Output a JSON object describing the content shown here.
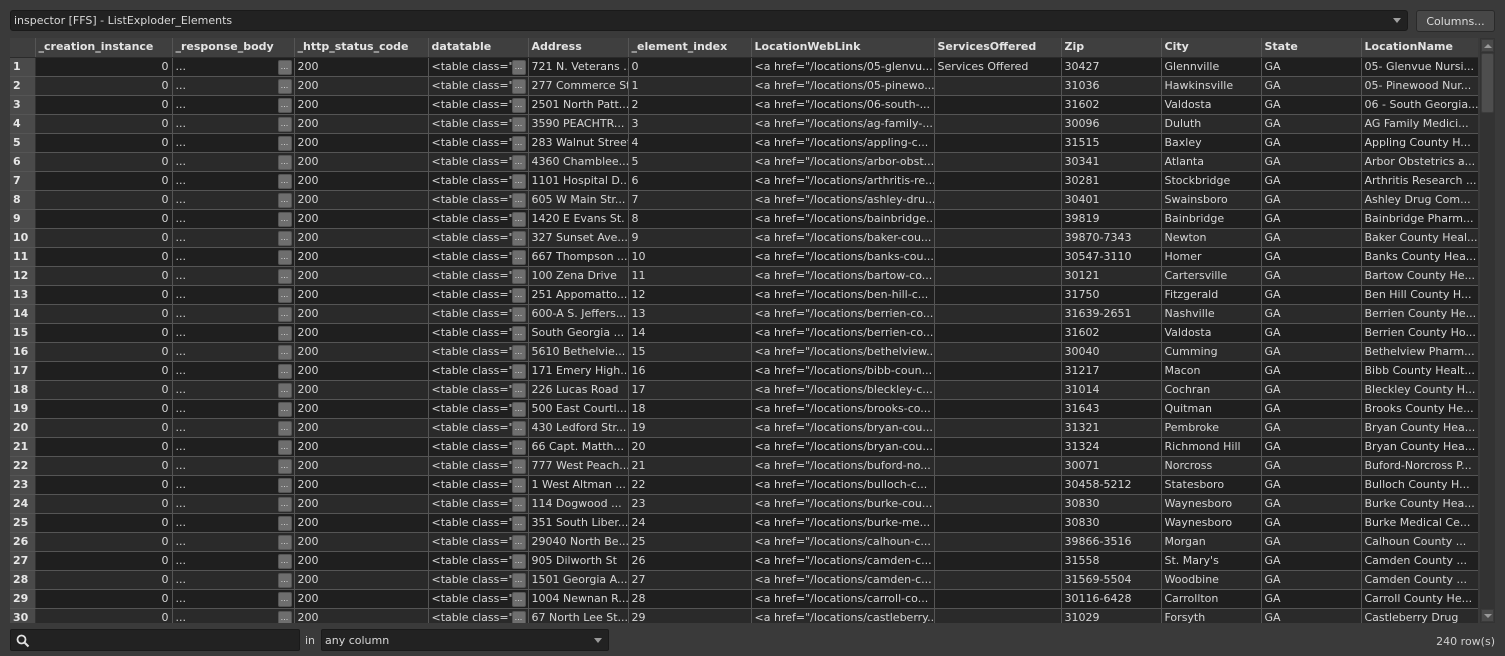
{
  "window": {
    "title": "inspector [FFS] - ListExploder_Elements",
    "columns_button": "Columns..."
  },
  "grid": {
    "columns": [
      "_creation_instance",
      "_response_body",
      "_http_status_code",
      "datatable",
      "Address",
      "_element_index",
      "LocationWebLink",
      "ServicesOffered",
      "Zip",
      "City",
      "State",
      "LocationName"
    ],
    "ellipsis_button": "...",
    "rows": [
      {
        "n": "1",
        "ci": "0",
        "rb": "...",
        "hs": "200",
        "dt": "<table class=\"c",
        "ad": "721 N. Veterans ...",
        "ei": "0",
        "lw": "<a href=\"/locations/05-glenvu...",
        "so": "Services Offered",
        "zip": "30427",
        "city": "Glennville",
        "st": "GA",
        "ln": "05- Glenvue Nursi..."
      },
      {
        "n": "2",
        "ci": "0",
        "rb": "...",
        "hs": "200",
        "dt": "<table class=\"c",
        "ad": "277 Commerce St",
        "ei": "1",
        "lw": "<a href=\"/locations/05-pinewo...",
        "so": "",
        "zip": "31036",
        "city": "Hawkinsville",
        "st": "GA",
        "ln": "05- Pinewood Nur..."
      },
      {
        "n": "3",
        "ci": "0",
        "rb": "...",
        "hs": "200",
        "dt": "<table class=\"c",
        "ad": "2501 North Patt...",
        "ei": "2",
        "lw": "<a href=\"/locations/06-south-...",
        "so": "",
        "zip": "31602",
        "city": "Valdosta",
        "st": "GA",
        "ln": "06 - South Georgia..."
      },
      {
        "n": "4",
        "ci": "0",
        "rb": "...",
        "hs": "200",
        "dt": "<table class=\"c",
        "ad": "3590 PEACHTR...",
        "ei": "3",
        "lw": "<a href=\"/locations/ag-family-...",
        "so": "",
        "zip": "30096",
        "city": "Duluth",
        "st": "GA",
        "ln": "AG Family Medici..."
      },
      {
        "n": "5",
        "ci": "0",
        "rb": "...",
        "hs": "200",
        "dt": "<table class=\"c",
        "ad": "283 Walnut Street",
        "ei": "4",
        "lw": "<a href=\"/locations/appling-c...",
        "so": "",
        "zip": "31515",
        "city": "Baxley",
        "st": "GA",
        "ln": "Appling County H..."
      },
      {
        "n": "6",
        "ci": "0",
        "rb": "...",
        "hs": "200",
        "dt": "<table class=\"c",
        "ad": "4360 Chamblee...",
        "ei": "5",
        "lw": "<a href=\"/locations/arbor-obst...",
        "so": "",
        "zip": "30341",
        "city": "Atlanta",
        "st": "GA",
        "ln": "Arbor Obstetrics a..."
      },
      {
        "n": "7",
        "ci": "0",
        "rb": "...",
        "hs": "200",
        "dt": "<table class=\"c",
        "ad": "1101 Hospital D...",
        "ei": "6",
        "lw": "<a href=\"/locations/arthritis-re...",
        "so": "",
        "zip": "30281",
        "city": "Stockbridge",
        "st": "GA",
        "ln": "Arthritis Research ..."
      },
      {
        "n": "8",
        "ci": "0",
        "rb": "...",
        "hs": "200",
        "dt": "<table class=\"c",
        "ad": "605 W Main Str...",
        "ei": "7",
        "lw": "<a href=\"/locations/ashley-dru...",
        "so": "",
        "zip": "30401",
        "city": "Swainsboro",
        "st": "GA",
        "ln": "Ashley Drug Com..."
      },
      {
        "n": "9",
        "ci": "0",
        "rb": "...",
        "hs": "200",
        "dt": "<table class=\"c",
        "ad": "1420 E Evans St.",
        "ei": "8",
        "lw": "<a href=\"/locations/bainbridge...",
        "so": "",
        "zip": "39819",
        "city": "Bainbridge",
        "st": "GA",
        "ln": "Bainbridge Pharm..."
      },
      {
        "n": "10",
        "ci": "0",
        "rb": "...",
        "hs": "200",
        "dt": "<table class=\"c",
        "ad": "327 Sunset Ave...",
        "ei": "9",
        "lw": "<a href=\"/locations/baker-cou...",
        "so": "",
        "zip": "39870-7343",
        "city": "Newton",
        "st": "GA",
        "ln": "Baker County Heal..."
      },
      {
        "n": "11",
        "ci": "0",
        "rb": "...",
        "hs": "200",
        "dt": "<table class=\"c",
        "ad": "667 Thompson ...",
        "ei": "10",
        "lw": "<a href=\"/locations/banks-cou...",
        "so": "",
        "zip": "30547-3110",
        "city": "Homer",
        "st": "GA",
        "ln": "Banks County Hea..."
      },
      {
        "n": "12",
        "ci": "0",
        "rb": "...",
        "hs": "200",
        "dt": "<table class=\"c",
        "ad": "100 Zena Drive",
        "ei": "11",
        "lw": "<a href=\"/locations/bartow-co...",
        "so": "",
        "zip": "30121",
        "city": "Cartersville",
        "st": "GA",
        "ln": "Bartow County He..."
      },
      {
        "n": "13",
        "ci": "0",
        "rb": "...",
        "hs": "200",
        "dt": "<table class=\"c",
        "ad": "251 Appomatto...",
        "ei": "12",
        "lw": "<a href=\"/locations/ben-hill-c...",
        "so": "",
        "zip": "31750",
        "city": "Fitzgerald",
        "st": "GA",
        "ln": "Ben Hill County H..."
      },
      {
        "n": "14",
        "ci": "0",
        "rb": "...",
        "hs": "200",
        "dt": "<table class=\"c",
        "ad": "600-A S. Jeffers...",
        "ei": "13",
        "lw": "<a href=\"/locations/berrien-co...",
        "so": "",
        "zip": "31639-2651",
        "city": "Nashville",
        "st": "GA",
        "ln": "Berrien County He..."
      },
      {
        "n": "15",
        "ci": "0",
        "rb": "...",
        "hs": "200",
        "dt": "<table class=\"c",
        "ad": "South Georgia ...",
        "ei": "14",
        "lw": "<a href=\"/locations/berrien-co...",
        "so": "",
        "zip": "31602",
        "city": "Valdosta",
        "st": "GA",
        "ln": "Berrien County Ho..."
      },
      {
        "n": "16",
        "ci": "0",
        "rb": "...",
        "hs": "200",
        "dt": "<table class=\"c",
        "ad": "5610 Bethelvie...",
        "ei": "15",
        "lw": "<a href=\"/locations/bethelview...",
        "so": "",
        "zip": "30040",
        "city": "Cumming",
        "st": "GA",
        "ln": "Bethelview Pharm..."
      },
      {
        "n": "17",
        "ci": "0",
        "rb": "...",
        "hs": "200",
        "dt": "<table class=\"c",
        "ad": "171 Emery High...",
        "ei": "16",
        "lw": "<a href=\"/locations/bibb-coun...",
        "so": "",
        "zip": "31217",
        "city": "Macon",
        "st": "GA",
        "ln": "Bibb County Healt..."
      },
      {
        "n": "18",
        "ci": "0",
        "rb": "...",
        "hs": "200",
        "dt": "<table class=\"c",
        "ad": "226 Lucas Road",
        "ei": "17",
        "lw": "<a href=\"/locations/bleckley-c...",
        "so": "",
        "zip": "31014",
        "city": "Cochran",
        "st": "GA",
        "ln": "Bleckley County H..."
      },
      {
        "n": "19",
        "ci": "0",
        "rb": "...",
        "hs": "200",
        "dt": "<table class=\"c",
        "ad": "500 East Courtl...",
        "ei": "18",
        "lw": "<a href=\"/locations/brooks-co...",
        "so": "",
        "zip": "31643",
        "city": "Quitman",
        "st": "GA",
        "ln": "Brooks County He..."
      },
      {
        "n": "20",
        "ci": "0",
        "rb": "...",
        "hs": "200",
        "dt": "<table class=\"c",
        "ad": "430 Ledford Str...",
        "ei": "19",
        "lw": "<a href=\"/locations/bryan-cou...",
        "so": "",
        "zip": "31321",
        "city": "Pembroke",
        "st": "GA",
        "ln": "Bryan County Hea..."
      },
      {
        "n": "21",
        "ci": "0",
        "rb": "...",
        "hs": "200",
        "dt": "<table class=\"c",
        "ad": "66 Capt. Matth...",
        "ei": "20",
        "lw": "<a href=\"/locations/bryan-cou...",
        "so": "",
        "zip": "31324",
        "city": "Richmond Hill",
        "st": "GA",
        "ln": "Bryan County Hea..."
      },
      {
        "n": "22",
        "ci": "0",
        "rb": "...",
        "hs": "200",
        "dt": "<table class=\"c",
        "ad": "777 West Peach...",
        "ei": "21",
        "lw": "<a href=\"/locations/buford-no...",
        "so": "",
        "zip": "30071",
        "city": "Norcross",
        "st": "GA",
        "ln": "Buford-Norcross P..."
      },
      {
        "n": "23",
        "ci": "0",
        "rb": "...",
        "hs": "200",
        "dt": "<table class=\"c",
        "ad": "1 West Altman ...",
        "ei": "22",
        "lw": "<a href=\"/locations/bulloch-c...",
        "so": "",
        "zip": "30458-5212",
        "city": "Statesboro",
        "st": "GA",
        "ln": "Bulloch County H..."
      },
      {
        "n": "24",
        "ci": "0",
        "rb": "...",
        "hs": "200",
        "dt": "<table class=\"c",
        "ad": "114 Dogwood ...",
        "ei": "23",
        "lw": "<a href=\"/locations/burke-cou...",
        "so": "",
        "zip": "30830",
        "city": "Waynesboro",
        "st": "GA",
        "ln": "Burke County Hea..."
      },
      {
        "n": "25",
        "ci": "0",
        "rb": "...",
        "hs": "200",
        "dt": "<table class=\"c",
        "ad": "351 South Liber...",
        "ei": "24",
        "lw": "<a href=\"/locations/burke-me...",
        "so": "",
        "zip": "30830",
        "city": "Waynesboro",
        "st": "GA",
        "ln": "Burke Medical  Ce..."
      },
      {
        "n": "26",
        "ci": "0",
        "rb": "...",
        "hs": "200",
        "dt": "<table class=\"c",
        "ad": "29040 North Be...",
        "ei": "25",
        "lw": "<a href=\"/locations/calhoun-c...",
        "so": "",
        "zip": "39866-3516",
        "city": "Morgan",
        "st": "GA",
        "ln": "Calhoun County ..."
      },
      {
        "n": "27",
        "ci": "0",
        "rb": "...",
        "hs": "200",
        "dt": "<table class=\"c",
        "ad": "905 Dilworth St",
        "ei": "26",
        "lw": "<a href=\"/locations/camden-c...",
        "so": "",
        "zip": "31558",
        "city": "St. Mary's",
        "st": "GA",
        "ln": "Camden County ..."
      },
      {
        "n": "28",
        "ci": "0",
        "rb": "...",
        "hs": "200",
        "dt": "<table class=\"c",
        "ad": "1501 Georgia A...",
        "ei": "27",
        "lw": "<a href=\"/locations/camden-c...",
        "so": "",
        "zip": "31569-5504",
        "city": "Woodbine",
        "st": "GA",
        "ln": "Camden County ..."
      },
      {
        "n": "29",
        "ci": "0",
        "rb": "...",
        "hs": "200",
        "dt": "<table class=\"c",
        "ad": "1004 Newnan R...",
        "ei": "28",
        "lw": "<a href=\"/locations/carroll-co...",
        "so": "",
        "zip": "30116-6428",
        "city": "Carrollton",
        "st": "GA",
        "ln": "Carroll County He..."
      },
      {
        "n": "30",
        "ci": "0",
        "rb": "...",
        "hs": "200",
        "dt": "<table class=\"c",
        "ad": "67 North Lee St...",
        "ei": "29",
        "lw": "<a href=\"/locations/castleberry...",
        "so": "",
        "zip": "31029",
        "city": "Forsyth",
        "st": "GA",
        "ln": "Castleberry Drug"
      }
    ]
  },
  "filter": {
    "search_value": "",
    "search_placeholder": "",
    "in_label": "in",
    "column_select": "any column"
  },
  "status": {
    "row_count": "240 row(s)"
  },
  "icons": {
    "search": "search-icon",
    "dropdown": "chevron-down-icon",
    "scroll_up": "scroll-up-icon",
    "scroll_down": "scroll-down-icon"
  },
  "colors": {
    "background": "#3a3a3a",
    "row_odd": "#1f1f1f",
    "row_even": "#2a2a2a",
    "header": "#3f3f3f",
    "row_header": "#4a4a4a"
  }
}
